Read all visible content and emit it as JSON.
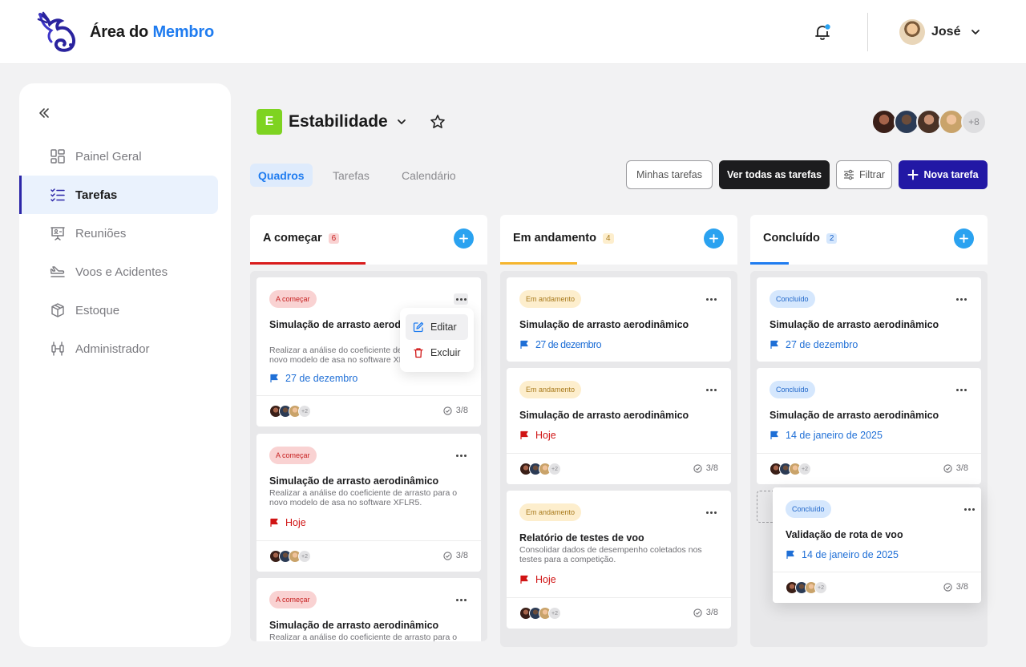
{
  "header": {
    "app_title_part1": "Área do",
    "app_title_part2": "Membro",
    "user_name": "José"
  },
  "sidebar": {
    "items": [
      {
        "label": "Painel Geral",
        "icon": "dashboard-icon"
      },
      {
        "label": "Tarefas",
        "icon": "tasks-icon",
        "active": true
      },
      {
        "label": "Reuniões",
        "icon": "presentation-icon"
      },
      {
        "label": "Voos e Acidentes",
        "icon": "plane-icon"
      },
      {
        "label": "Estoque",
        "icon": "box-icon"
      },
      {
        "label": "Administrador",
        "icon": "admin-icon"
      }
    ]
  },
  "project": {
    "badge": "E",
    "name": "Estabilidade",
    "team_more": "+8"
  },
  "tabs": [
    "Quadros",
    "Tarefas",
    "Calendário"
  ],
  "actions": {
    "my_tasks": "Minhas tarefas",
    "all_tasks": "Ver todas as tarefas",
    "filter": "Filtrar",
    "new_task": "Nova tarefa"
  },
  "columns": [
    {
      "title": "A começar",
      "count": "6",
      "color": "#d91c1c",
      "cards": [
        {
          "tag": "A começar",
          "title": "Simulação de arrasto aerodinâmico",
          "desc": "Realizar a análise do coeficiente de arrasto para o novo modelo de asa no software XFLR5.",
          "due": "27 de dezembro",
          "plus": "+2",
          "progress": "3/8"
        },
        {
          "tag": "A começar",
          "title": "Simulação de arrasto aerodinâmico",
          "desc": "Realizar a análise do coeficiente de arrasto para o novo modelo de asa no software XFLR5.",
          "due": "Hoje",
          "plus": "+2",
          "progress": "3/8"
        },
        {
          "tag": "A começar",
          "title": "Simulação de arrasto aerodinâmico",
          "desc": "Realizar a análise do coeficiente de arrasto para o"
        }
      ]
    },
    {
      "title": "Em andamento",
      "count": "4",
      "color": "#f5b52e",
      "cards": [
        {
          "tag": "Em andamento",
          "title": "Simulação de arrasto aerodinâmico",
          "due": "27 de dezembro"
        },
        {
          "tag": "Em andamento",
          "title": "Simulação de arrasto aerodinâmico",
          "due": "Hoje",
          "plus": "+2",
          "progress": "3/8"
        },
        {
          "tag": "Em andamento",
          "title": "Relatório de testes de voo",
          "desc": "Consolidar dados de desempenho coletados nos testes para a competição.",
          "due": "Hoje",
          "plus": "+2",
          "progress": "3/8"
        }
      ]
    },
    {
      "title": "Concluído",
      "count": "2",
      "color": "#1f7cf0",
      "cards": [
        {
          "tag": "Concluído",
          "title": "Simulação de arrasto aerodinâmico",
          "due": "27 de dezembro"
        },
        {
          "tag": "Concluído",
          "title": "Simulação de arrasto aerodinâmico",
          "due": "14 de janeiro de 2025",
          "plus": "+2",
          "progress": "3/8"
        }
      ]
    }
  ],
  "menu": {
    "edit": "Editar",
    "delete": "Excluir"
  },
  "dragged_card": {
    "tag": "Concluído",
    "title": "Validação de rota de voo",
    "due": "14 de janeiro de 2025",
    "plus": "+2",
    "progress": "3/8"
  }
}
